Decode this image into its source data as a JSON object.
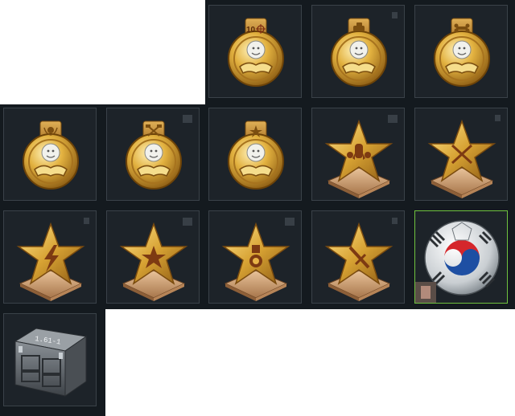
{
  "colors": {
    "panel_bg": "#141a1f",
    "tile_bg": "#1d2329",
    "tile_border": "#3a4249",
    "selected_border": "#6fc23f",
    "gold": "#d8a634"
  },
  "rewards": [
    {
      "icon": "lion-medal-crosshair-icon",
      "ribbon_text": "10"
    },
    {
      "icon": "lion-medal-tank-icon"
    },
    {
      "icon": "lion-medal-bone-icon"
    },
    {
      "icon": "lion-medal-wreath-icon"
    },
    {
      "icon": "lion-medal-hammers-icon"
    },
    {
      "icon": "lion-medal-star-icon"
    },
    {
      "icon": "gold-star-bomb-icon"
    },
    {
      "icon": "gold-star-crossed-swords-icon"
    },
    {
      "icon": "gold-star-lightning-icon"
    },
    {
      "icon": "gold-star-star-icon"
    },
    {
      "icon": "gold-star-medal-icon"
    },
    {
      "icon": "gold-star-dagger-icon"
    },
    {
      "icon": "korea-soccer-ball-icon",
      "selected": true
    },
    {
      "icon": "metal-crate-icon",
      "crate_label": "1.61-1"
    }
  ]
}
